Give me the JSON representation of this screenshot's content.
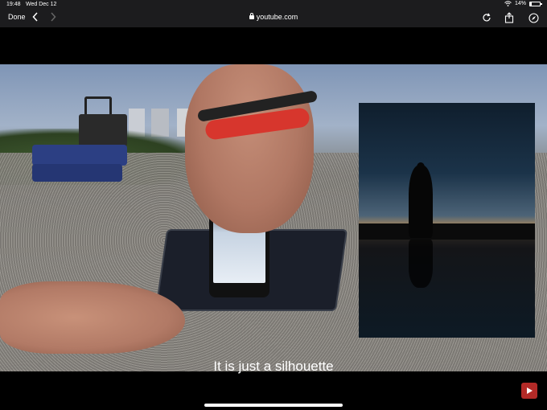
{
  "status_bar": {
    "time": "19:48",
    "date": "Wed Dec 12",
    "battery": "14%",
    "battery_level": 0.14
  },
  "toolbar": {
    "done_label": "Done",
    "url": "youtube.com"
  },
  "video": {
    "caption": "It is just a silhouette"
  },
  "colors": {
    "chrome_bg": "#1c1c1e",
    "youtube_red": "#b32a27",
    "wristband_red": "#d7362d"
  },
  "icons": [
    "chevron-left-icon",
    "chevron-right-icon",
    "lock-icon",
    "reload-icon",
    "share-icon",
    "compass-icon",
    "wifi-icon",
    "battery-icon",
    "youtube-logo-icon"
  ]
}
